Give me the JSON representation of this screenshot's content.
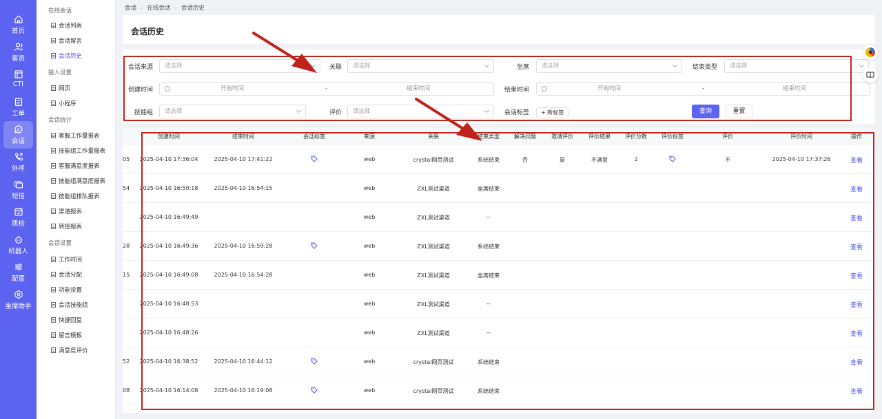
{
  "nav": [
    {
      "label": "首页",
      "icon": "home-icon"
    },
    {
      "label": "客资",
      "icon": "customers-icon"
    },
    {
      "label": "CTI",
      "icon": "cti-icon"
    },
    {
      "label": "工单",
      "icon": "ticket-icon"
    },
    {
      "label": "会话",
      "icon": "chat-icon"
    },
    {
      "label": "外呼",
      "icon": "phone-out-icon"
    },
    {
      "label": "短信",
      "icon": "sms-icon"
    },
    {
      "label": "质检",
      "icon": "quality-icon"
    },
    {
      "label": "机器人",
      "icon": "robot-icon"
    },
    {
      "label": "配置",
      "icon": "settings-sliders-icon"
    },
    {
      "label": "坐席助手",
      "icon": "assistant-icon"
    }
  ],
  "submenu": {
    "g1": "在线会话",
    "g1_items": [
      "会话列表",
      "会话留言",
      "会话历史"
    ],
    "g2": "接入设置",
    "g2_items": [
      "网页",
      "小程序"
    ],
    "g3": "会话统计",
    "g3_items": [
      "客服工作量报表",
      "技能组工作量报表",
      "客服满意度报表",
      "技能组满意度报表",
      "技能组排队报表",
      "渠道报表",
      "转接报表"
    ],
    "g4": "会话设置",
    "g4_items": [
      "工作时间",
      "会话分配",
      "功能设置",
      "会话技能组",
      "快捷回复",
      "留言模板",
      "满意度评价"
    ]
  },
  "breadcrumb": [
    "会话",
    "在线会话",
    "会话历史"
  ],
  "page_title": "会话历史",
  "filters": {
    "source_label": "会话来源",
    "assoc_label": "关联",
    "agent_label": "坐席",
    "endtype_label": "结束类型",
    "created_label": "创建时间",
    "ended_label": "结束时间",
    "skill_label": "技能组",
    "rating_label": "评价",
    "tag_label": "会话标签",
    "placeholder": "请选择",
    "start_placeholder": "开始时间",
    "end_placeholder": "结束时间",
    "range_dash": "-",
    "new_tag": "+ 新标签",
    "query": "查询",
    "reset": "重置"
  },
  "table": {
    "headers": [
      "创建时间",
      "结束时间",
      "会话标签",
      "来源",
      "关联",
      "结束类型",
      "解决问题",
      "邀请评价",
      "评价结果",
      "评价分数",
      "评价标签",
      "评价",
      "评价时间",
      "操作"
    ],
    "rows": [
      {
        "cut": "05",
        "created": "2025-04-10 17:36:04",
        "ended": "2025-04-10 17:41:22",
        "tag": true,
        "source": "web",
        "assoc": "crystal网页测试",
        "endtype": "系统结束",
        "solved": "否",
        "invited": "是",
        "result": "不满意",
        "score": "2",
        "rtag": true,
        "rating": "不",
        "rtime": "2025-04-10 17:37:26",
        "op": "查看"
      },
      {
        "cut": "54",
        "created": "2025-04-10 16:50:18",
        "ended": "2025-04-10 16:54:15",
        "tag": false,
        "source": "web",
        "assoc": "ZXL测试渠道",
        "endtype": "坐席结束",
        "solved": "",
        "invited": "",
        "result": "",
        "score": "",
        "rtag": false,
        "rating": "",
        "rtime": "",
        "op": "查看"
      },
      {
        "cut": "",
        "created": "2025-04-10 16:49:49",
        "ended": "",
        "tag": false,
        "source": "web",
        "assoc": "ZXL测试渠道",
        "endtype": "--",
        "solved": "",
        "invited": "",
        "result": "",
        "score": "",
        "rtag": false,
        "rating": "",
        "rtime": "",
        "op": "查看"
      },
      {
        "cut": "28",
        "created": "2025-04-10 16:49:36",
        "ended": "2025-04-10 16:59:28",
        "tag": true,
        "source": "web",
        "assoc": "ZXL测试渠道",
        "endtype": "系统结束",
        "solved": "",
        "invited": "",
        "result": "",
        "score": "",
        "rtag": false,
        "rating": "",
        "rtime": "",
        "op": "查看"
      },
      {
        "cut": "15",
        "created": "2025-04-10 16:49:08",
        "ended": "2025-04-10 16:54:28",
        "tag": false,
        "source": "web",
        "assoc": "ZXL测试渠道",
        "endtype": "坐席结束",
        "solved": "",
        "invited": "",
        "result": "",
        "score": "",
        "rtag": false,
        "rating": "",
        "rtime": "",
        "op": "查看"
      },
      {
        "cut": "",
        "created": "2025-04-10 16:48:53",
        "ended": "",
        "tag": false,
        "source": "web",
        "assoc": "ZXL测试渠道",
        "endtype": "--",
        "solved": "",
        "invited": "",
        "result": "",
        "score": "",
        "rtag": false,
        "rating": "",
        "rtime": "",
        "op": "查看"
      },
      {
        "cut": "",
        "created": "2025-04-10 16:48:26",
        "ended": "",
        "tag": false,
        "source": "web",
        "assoc": "ZXL测试渠道",
        "endtype": "--",
        "solved": "",
        "invited": "",
        "result": "",
        "score": "",
        "rtag": false,
        "rating": "",
        "rtime": "",
        "op": "查看"
      },
      {
        "cut": "52",
        "created": "2025-04-10 16:38:52",
        "ended": "2025-04-10 16:44:12",
        "tag": true,
        "source": "web",
        "assoc": "crystal网页测试",
        "endtype": "系统结束",
        "solved": "",
        "invited": "",
        "result": "",
        "score": "",
        "rtag": false,
        "rating": "",
        "rtime": "",
        "op": "查看"
      },
      {
        "cut": "08",
        "created": "2025-04-10 16:14:08",
        "ended": "2025-04-10 16:19:08",
        "tag": true,
        "source": "web",
        "assoc": "crystal网页测试",
        "endtype": "系统结束",
        "solved": "",
        "invited": "",
        "result": "",
        "score": "",
        "rtag": false,
        "rating": "",
        "rtime": "",
        "op": "查看"
      }
    ]
  },
  "colors": {
    "brand": "#5b63f0",
    "annotation": "#c0221c",
    "link": "#4f57e8"
  }
}
